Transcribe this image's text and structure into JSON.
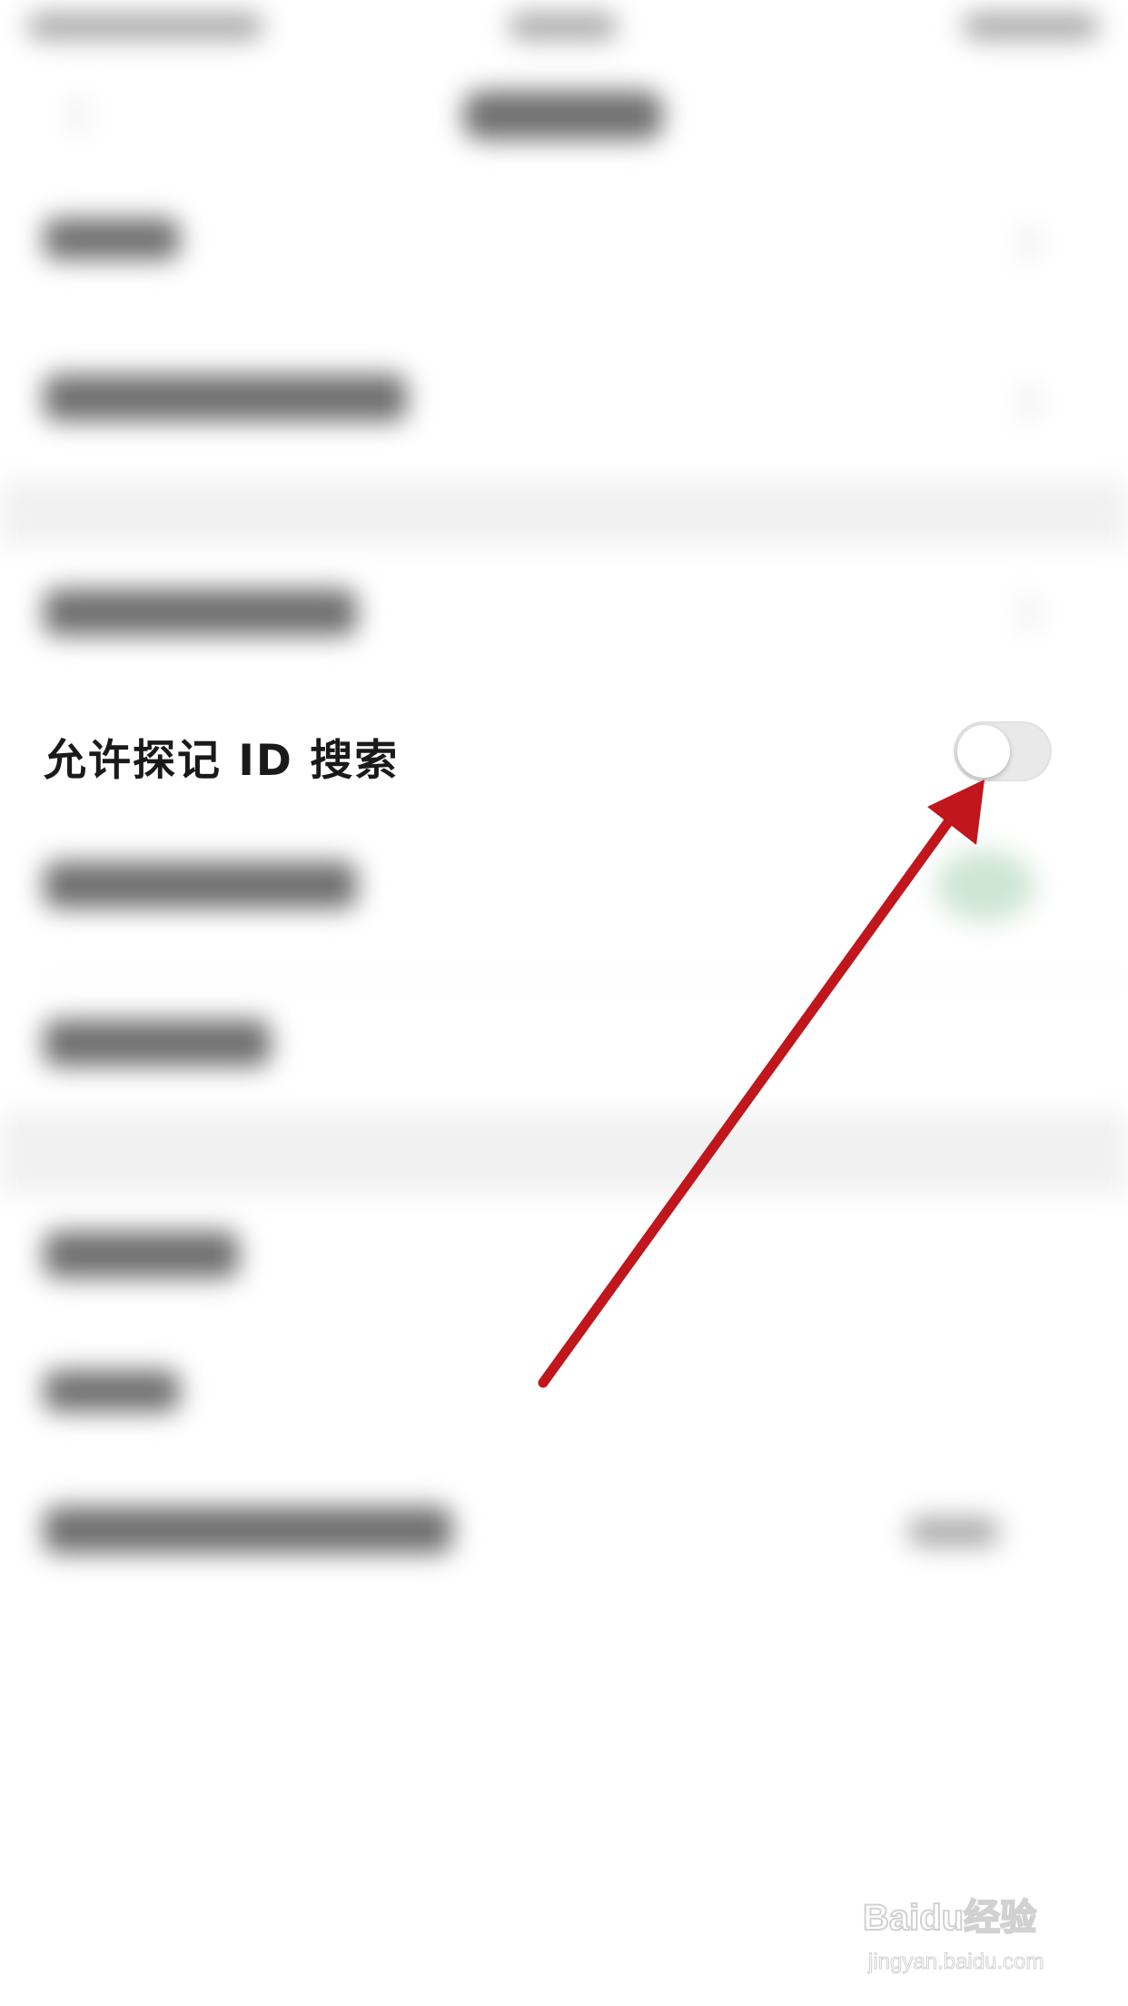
{
  "setting_row": {
    "label": "允许探记 ID 搜索",
    "toggle_on": false
  },
  "watermark": {
    "brand": "Baidu经验",
    "url": "jingyan.baidu.com"
  },
  "colors": {
    "arrow": "#c0161c",
    "toggle_off_track": "#e9e9e9",
    "green_blob": "#cfe6d4"
  },
  "icons": {
    "back": "back-arrow-icon",
    "row_chevron": "chevron-right-icon",
    "annotation": "red-arrow-annotation-icon"
  }
}
